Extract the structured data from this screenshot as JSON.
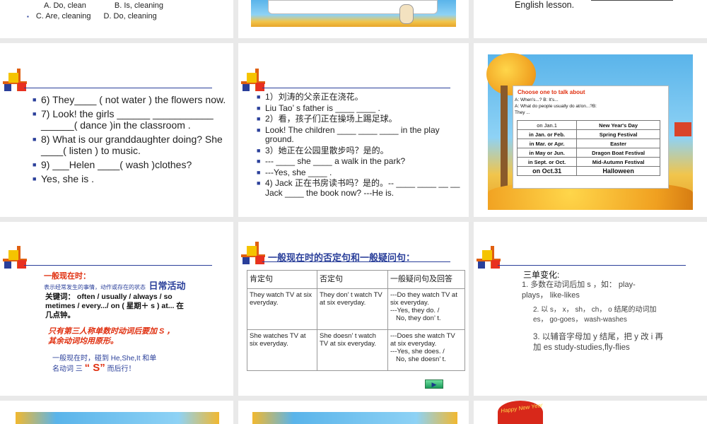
{
  "slide_top_left": {
    "line1": "A. Do, clean",
    "line1b": "B. Is, cleaning",
    "line2a": "C. Are, cleaning",
    "line2b": "D. Do, cleaning"
  },
  "slide_top_right": {
    "text": "English lesson."
  },
  "slide_questions": {
    "items": [
      "6) They____ ( not water ) the flowers now.",
      "7) Look! the girls ______ ___________ ______( dance )in the classroom .",
      "8) What is our granddaughter doing? She ____( listen ) to music.",
      "9) ___Helen ____( wash )clothes?",
      " Yes, she is ."
    ]
  },
  "slide_translate": {
    "items": [
      "1）刘涛的父亲正在浇花。",
      "Liu Tao’ s father is ____ ____ .",
      "2）看，孩子们正在操场上踢足球。",
      "Look! The children ____ ____ ____ in the play ground.",
      "3）她正在公园里散步吗？是的。",
      "--- ____ she ____ a walk in the park?",
      " ---Yes, she ____ .",
      "4) Jack 正在书房读书吗？是的。-- ____ ____ __ __ Jack ____ the book now? ---He is."
    ]
  },
  "slide_festival": {
    "title": "Choose one to talk about",
    "prompt1": "A: When's...? B: It's...",
    "prompt2": " A: What do people usually do at/on...?B:",
    "prompt3": "They ...",
    "rows": [
      [
        "on Jan.1",
        "New Year's Day"
      ],
      [
        "in Jan. or Feb.",
        "Spring Festival"
      ],
      [
        "in Mar. or Apr.",
        "Easter"
      ],
      [
        "in May or Jun.",
        "Dragon Boat Festival"
      ],
      [
        "in Sept. or Oct.",
        "Mid-Autumn Festival"
      ],
      [
        "on Oct.31",
        "Halloween"
      ]
    ]
  },
  "slide_present": {
    "heading": "一般现在时：",
    "def_small": "表示经常发生的事情，动作或存在的状态",
    "def_big": "日常活动",
    "keywords": "关键词：  often / usually / always / so metimes / every.../ on ( 星期＋ s ) at... 在几点钟。",
    "rule_red": "只有第三人称单数时动词后要加 S ，其余动词均用原形。",
    "rule_blue1": "一般现在时，碰到 He,She,It 和单",
    "rule_blue2": "名动词 三 ",
    "rule_s": "“ S”",
    "rule_blue3": " 而后行！"
  },
  "slide_table": {
    "title": "一般现在时的否定句和一般疑问句：",
    "headers": [
      "肯定句",
      "否定句",
      "一般疑问句及回答"
    ],
    "r1c1": "They watch TV at six everyday.",
    "r1c2": "They don’ t watch TV at six everyday.",
    "r1c3a": "---Do they watch TV at six everyday.",
    "r1c3b": "---Yes, they do. /",
    "r1c3c": "No, they don’ t.",
    "r2c1": "She watches TV at six everyday.",
    "r2c2": "She doesn’ t watch TV at six everyday.",
    "r2c3a": "---Does she watch TV at six everyday.",
    "r2c3b": "---Yes, she does. /",
    "r2c3c": "No, she doesn’ t.",
    "play": "▶"
  },
  "slide_third": {
    "heading": "三单变化:",
    "r1": "1. 多数在动词后加 s ，如： play-plays， like-likes",
    "r2": "2. 以 s， x， sh， ch， o 结尾的动词加 es， go-goes， wash-washes",
    "r3": "3. 以辅音字母加 y 结尾，把 y 改 i 再加 es  study-studies,fly-flies"
  },
  "slide_bottom_right": {
    "badge": "Happy New Year"
  }
}
